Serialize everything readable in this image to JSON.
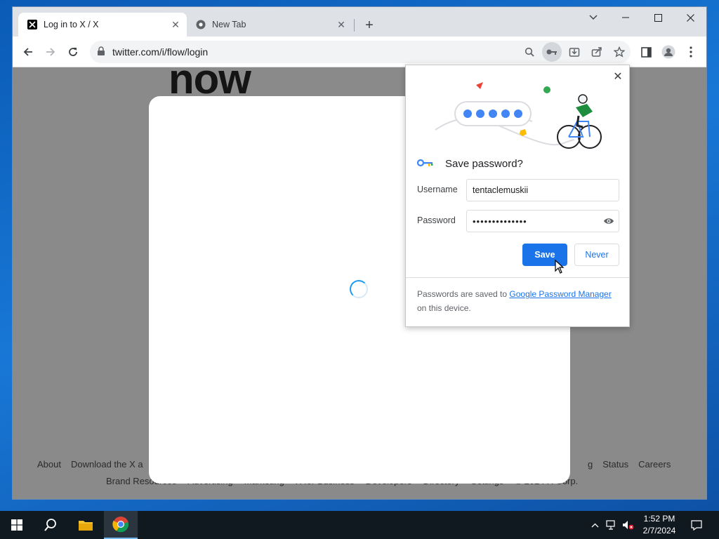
{
  "browser": {
    "tabs": [
      {
        "title": "Log in to X / X",
        "active": true,
        "favicon": "x-logo-icon"
      },
      {
        "title": "New Tab",
        "active": false,
        "favicon": "chrome-icon"
      }
    ],
    "address": "twitter.com/i/flow/login"
  },
  "page": {
    "background_word": "now",
    "footer_row1_left": [
      "About",
      "Download the X a"
    ],
    "footer_row1_right": [
      "g",
      "Status",
      "Careers"
    ],
    "footer_row2": [
      "Brand Resources",
      "Advertising",
      "Marketing",
      "X for Business",
      "Developers",
      "Directory",
      "Settings",
      "© 2024 X Corp."
    ]
  },
  "save_password": {
    "title": "Save password?",
    "username_label": "Username",
    "username_value": "tentaclemuskii",
    "password_label": "Password",
    "password_value": "••••••••••••••",
    "save_label": "Save",
    "never_label": "Never",
    "footnote_prefix": "Passwords are saved to ",
    "footnote_link": "Google Password Manager",
    "footnote_suffix": " on this device."
  },
  "taskbar": {
    "time": "1:52 PM",
    "date": "2/7/2024"
  },
  "colors": {
    "accent": "#1a73e8",
    "overlay": "#8a8a8a",
    "taskbar": "#101820"
  }
}
